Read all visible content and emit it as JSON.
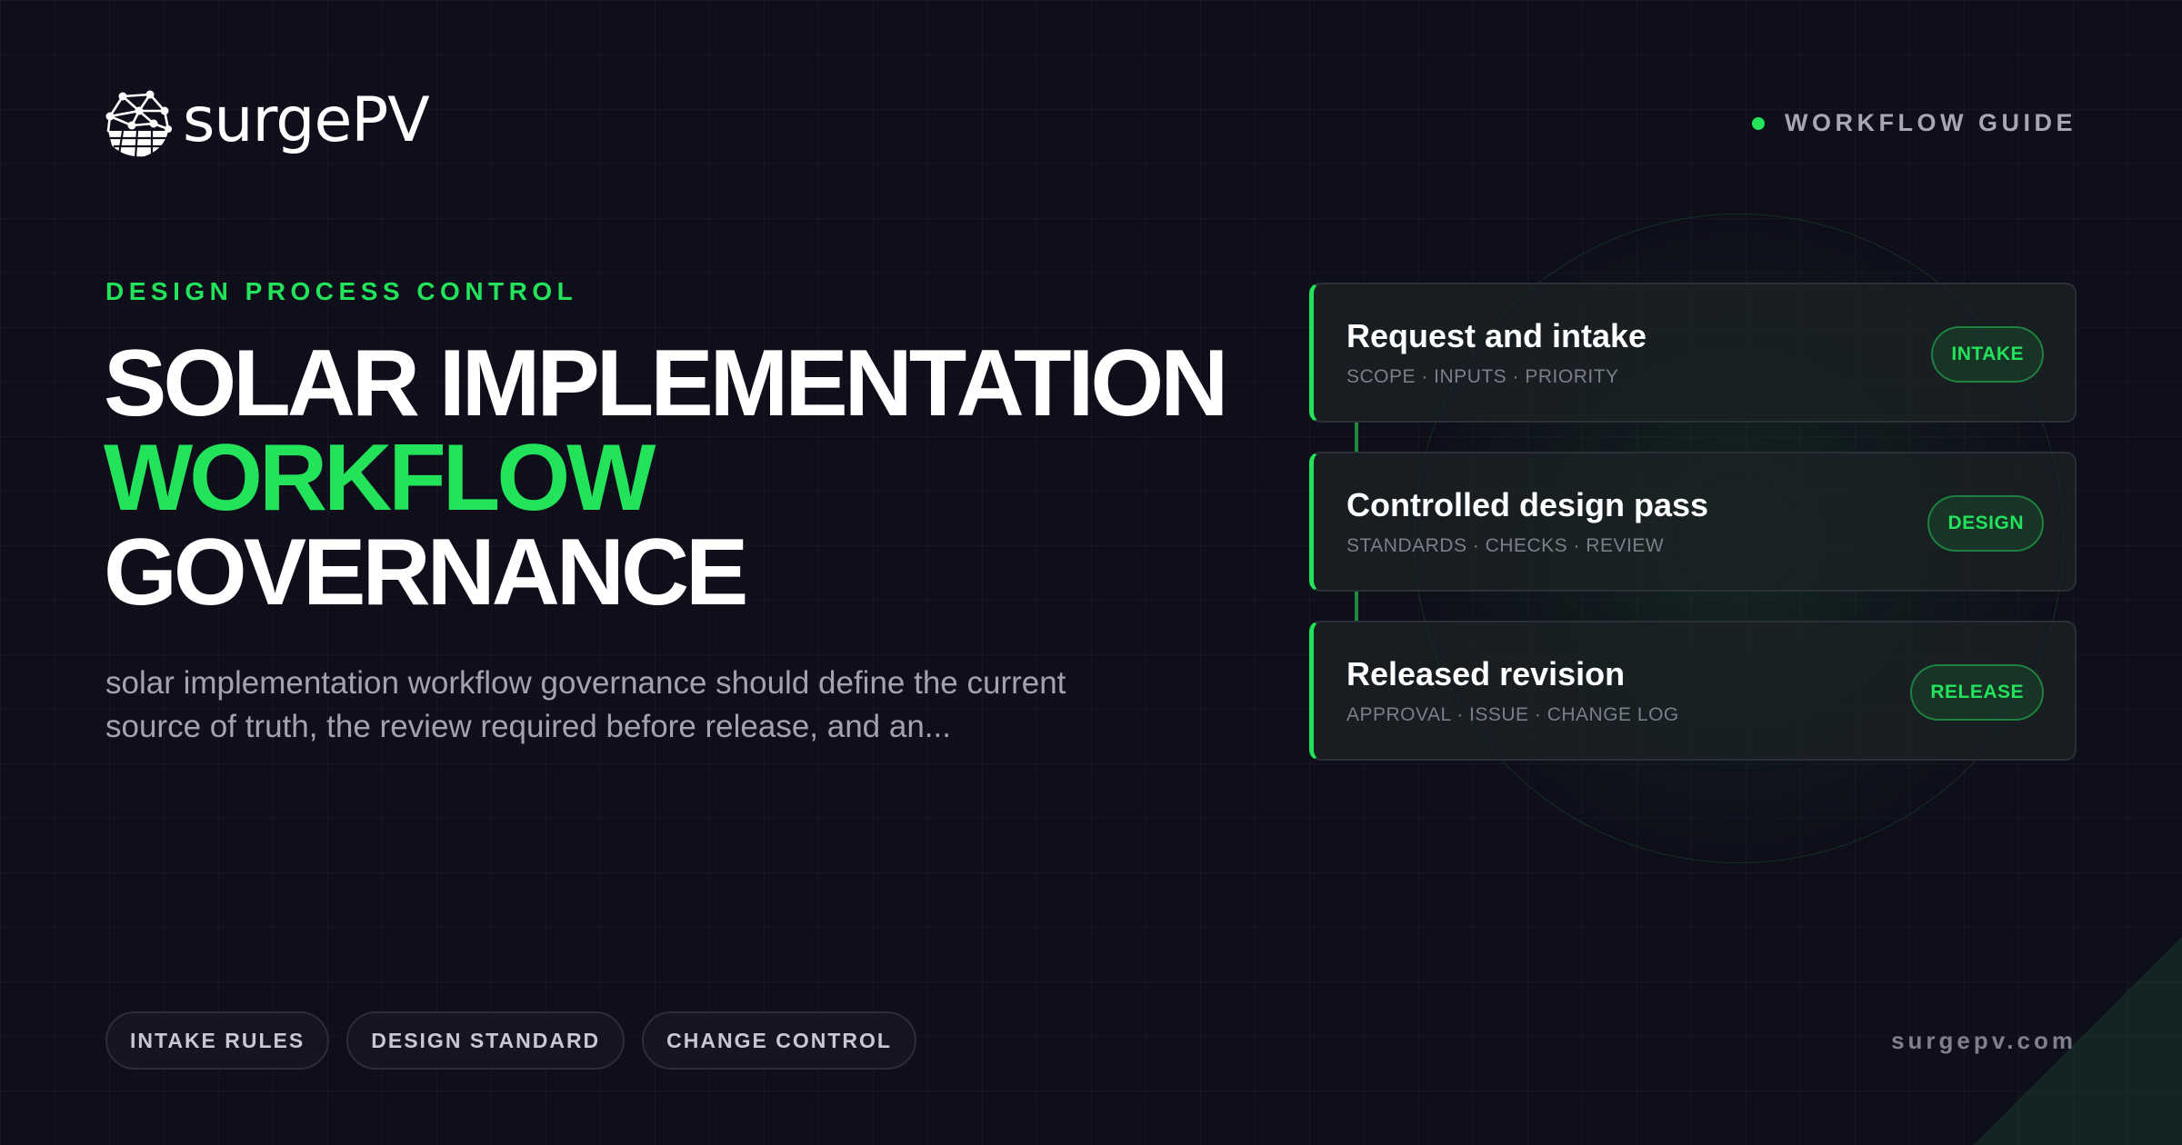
{
  "brand": {
    "name": "surgePV",
    "logo_icon": "solar-globe-icon"
  },
  "header": {
    "guide_label": "WORKFLOW GUIDE"
  },
  "hero": {
    "eyebrow": "DESIGN PROCESS CONTROL",
    "title_line1": "SOLAR IMPLEMENTATION",
    "title_line2": "WORKFLOW",
    "title_line3": "GOVERNANCE",
    "description_line1": "solar implementation workflow governance should define the current",
    "description_line2": "source of truth, the review required before release, and an..."
  },
  "chips": [
    "INTAKE RULES",
    "DESIGN STANDARD",
    "CHANGE CONTROL"
  ],
  "footer": {
    "site": "surgepv.com"
  },
  "workflow": [
    {
      "title": "Request and intake",
      "subtitle": "SCOPE · INPUTS · PRIORITY",
      "badge": "INTAKE"
    },
    {
      "title": "Controlled design pass",
      "subtitle": "STANDARDS · CHECKS · REVIEW",
      "badge": "DESIGN"
    },
    {
      "title": "Released revision",
      "subtitle": "APPROVAL · ISSUE · CHANGE LOG",
      "badge": "RELEASE"
    }
  ],
  "colors": {
    "accent": "#22e35a",
    "background": "#0f0f1b",
    "muted_text": "#a3a3b0"
  }
}
